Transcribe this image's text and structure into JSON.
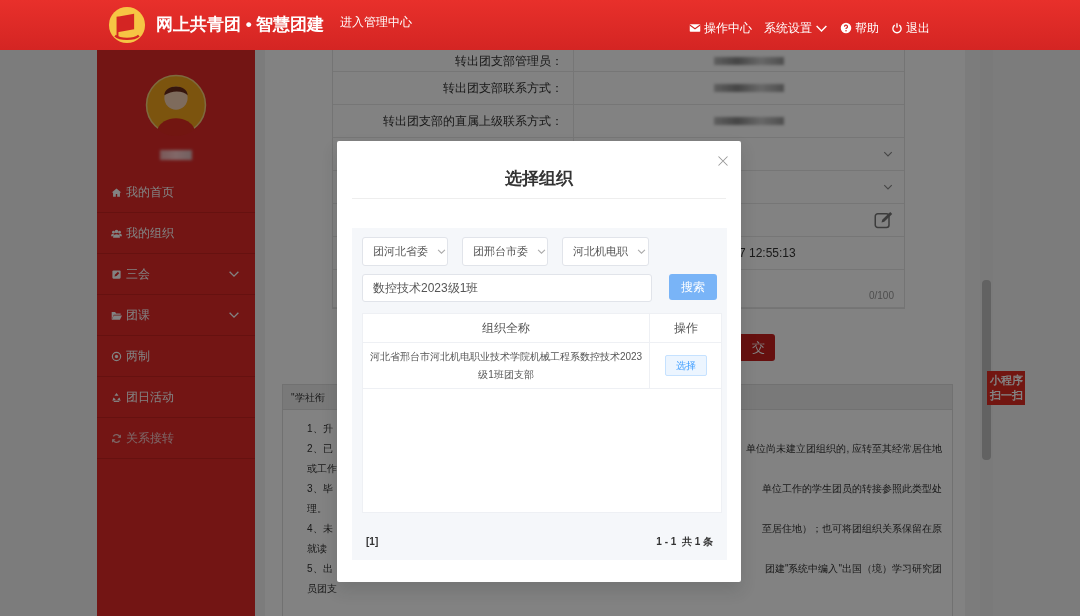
{
  "header": {
    "title": "网上共青团 • 智慧团建",
    "admin_link": "进入管理中心",
    "nav": [
      {
        "kind": "mail",
        "label": "操作中心"
      },
      {
        "kind": "dropdown",
        "label": "系统设置"
      },
      {
        "kind": "help",
        "label": "帮助"
      },
      {
        "kind": "power",
        "label": "退出"
      }
    ]
  },
  "sidebar": {
    "items": [
      {
        "label": "我的首页",
        "expandable": false,
        "selected": false
      },
      {
        "label": "我的组织",
        "expandable": false,
        "selected": false
      },
      {
        "label": "三会",
        "expandable": true,
        "selected": false
      },
      {
        "label": "团课",
        "expandable": true,
        "selected": false
      },
      {
        "label": "两制",
        "expandable": false,
        "selected": false
      },
      {
        "label": "团日活动",
        "expandable": false,
        "selected": false
      },
      {
        "label": "关系接转",
        "expandable": false,
        "selected": true
      }
    ]
  },
  "form": {
    "rows": [
      {
        "kind": "text",
        "label": "转出团支部管理员："
      },
      {
        "kind": "text",
        "label": "转出团支部联系方式："
      },
      {
        "kind": "text",
        "label": "转出团支部的直属上级联系方式："
      },
      {
        "kind": "select"
      },
      {
        "kind": "select"
      },
      {
        "kind": "edit"
      },
      {
        "kind": "datetime",
        "value": "7 12:55:13"
      },
      {
        "kind": "textarea",
        "counter": "0/100"
      }
    ],
    "submit_button": "交"
  },
  "notice": {
    "title": "\"学社衔",
    "lines": [
      {
        "left": "1、升"
      },
      {
        "left": "2、已",
        "right": "单位尚未建立团组织的, 应转至其经常居住地"
      },
      {
        "left": "或工作"
      },
      {
        "left": "3、毕",
        "right": "单位工作的学生团员的转接参照此类型处"
      },
      {
        "left": "理。"
      },
      {
        "left": "4、未",
        "right": "至居住地）；也可将团组织关系保留在原"
      },
      {
        "left": "就读"
      },
      {
        "left": "5、出",
        "right": "团建\"系统中编入\"出国（境）学习研究团"
      },
      {
        "left": "员团支"
      }
    ]
  },
  "mini_program_badge": "小程序扫一扫",
  "modal": {
    "title": "选择组织",
    "filters": [
      {
        "value": "团河北省委"
      },
      {
        "value": "团邢台市委"
      },
      {
        "value": "河北机电职"
      }
    ],
    "search": {
      "value": "数控技术2023级1班"
    },
    "search_button": "搜索",
    "table": {
      "columns": [
        "组织全称",
        "操作"
      ],
      "rows": [
        {
          "name": "河北省邢台市河北机电职业技术学院机械工程系数控技术2023级1班团支部",
          "action": "选择"
        }
      ]
    },
    "pagination": {
      "pages": "[1]",
      "summary": "1 - 1  共 1 条"
    }
  }
}
